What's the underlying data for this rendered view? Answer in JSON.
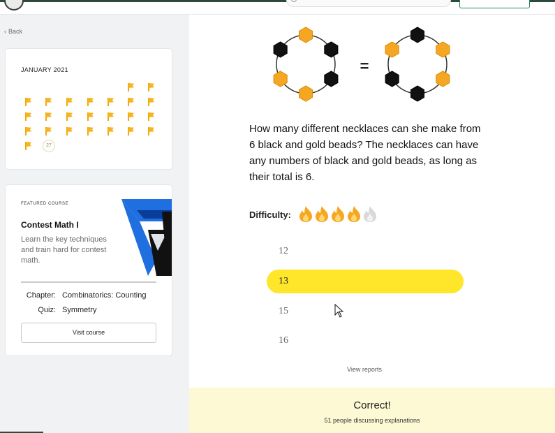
{
  "nav": {
    "back_label": "Back"
  },
  "calendar": {
    "title": "JANUARY 2021",
    "completed_days": 24,
    "current_day": "27"
  },
  "course": {
    "featured_label": "FEATURED COURSE",
    "title": "Contest Math I",
    "description": "Learn the key techniques and train hard for contest math.",
    "chapter_label": "Chapter:",
    "chapter_value": "Combinatorics: Counting",
    "quiz_label": "Quiz:",
    "quiz_value": "Symmetry",
    "visit_label": "Visit course"
  },
  "problem": {
    "equals_sign": "=",
    "necklace_left": [
      "gold",
      "black",
      "black",
      "gold",
      "gold",
      "black"
    ],
    "necklace_right": [
      "black",
      "gold",
      "gold",
      "black",
      "black",
      "gold"
    ],
    "question": "How many different necklaces can she make from 6 black and gold beads? The necklaces can have any numbers of black and gold beads, as long as their total is 6.",
    "difficulty_label": "Difficulty:",
    "difficulty_level": 4,
    "difficulty_max": 5,
    "options": [
      "12",
      "13",
      "15",
      "16"
    ],
    "selected_option": "13",
    "view_reports_label": "View reports"
  },
  "result": {
    "title": "Correct!",
    "subtitle": "51 people discussing explanations"
  },
  "colors": {
    "gold": "#f5a623",
    "black": "#111111",
    "selected": "#ffe62a",
    "banner": "#fdf9d4"
  }
}
